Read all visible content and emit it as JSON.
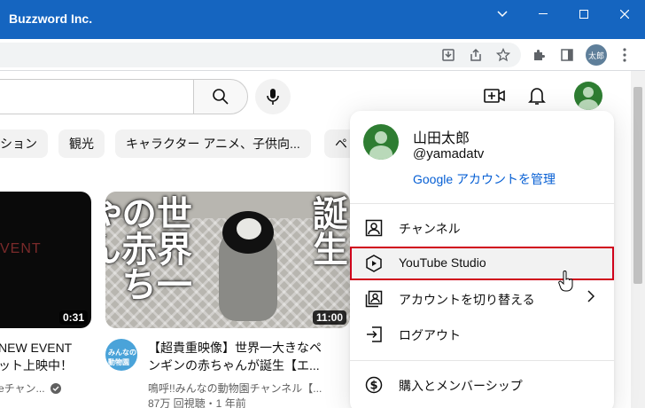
{
  "window": {
    "title": "Buzzword Inc.",
    "profile_initials": "太郎"
  },
  "chips": [
    "ション",
    "観光",
    "キャラクター アニメ、子供向...",
    "ペ"
  ],
  "videos": {
    "left": {
      "thumb_text": "VENT",
      "duration": "0:31",
      "title_line1": "NEW EVENT",
      "title_line2": "ット上映中！",
      "channel": "eチャン..."
    },
    "right": {
      "thumb_left_text": "世界一の赤ちゃん",
      "thumb_right_text": "誕生",
      "duration": "11:00",
      "title_line1": "【超貴重映像】世界一大きなペ",
      "title_line2": "ンギンの赤ちゃんが誕生【エ...",
      "channel": "鳴呼!!みんなの動物園チャンネル【...",
      "stats": "87万 回視聴・1 年前",
      "channel_avatar_text": "みんなの動物園"
    }
  },
  "account_menu": {
    "name": "山田太郎",
    "handle": "@yamadatv",
    "manage_link": "Google アカウントを管理",
    "items": [
      {
        "label": "チャンネル",
        "icon": "person-box-icon"
      },
      {
        "label": "YouTube Studio",
        "icon": "studio-icon",
        "highlighted": true
      },
      {
        "label": "アカウントを切り替える",
        "icon": "switch-account-icon",
        "has_submenu": true
      },
      {
        "label": "ログアウト",
        "icon": "sign-out-icon"
      },
      {
        "label": "購入とメンバーシップ",
        "icon": "dollar-icon"
      }
    ]
  },
  "colors": {
    "titlebar": "#1565c0",
    "highlight_border": "#d0021b",
    "link": "#065fd4",
    "avatar": "#2e7d32"
  }
}
